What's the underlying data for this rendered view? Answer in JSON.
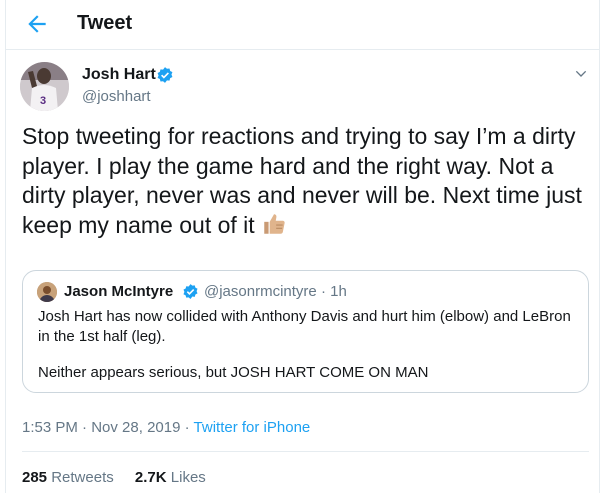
{
  "header": {
    "title": "Tweet",
    "back_icon": "arrow-left-icon"
  },
  "author": {
    "name": "Josh Hart",
    "handle": "@joshhart",
    "avatar_jersey_number": "3"
  },
  "tweet": {
    "text": "Stop tweeting for reactions and trying to say I’m a dirty player. I play the game hard and the right way. Not a dirty player, never was and never will be. Next time just keep my name out of it",
    "emoji": "thumbs-up-icon"
  },
  "quote": {
    "name": "Jason McIntyre",
    "handle": "@jasonrmcintyre",
    "separator": "·",
    "time": "1h",
    "paragraph1": "Josh Hart has now collided with Anthony Davis and hurt him (elbow) and LeBron in the 1st half (leg).",
    "paragraph2": "Neither appears serious, but JOSH HART COME ON MAN"
  },
  "meta": {
    "time": "1:53 PM",
    "separator": "·",
    "date": "Nov 28, 2019",
    "source": "Twitter for iPhone"
  },
  "stats": {
    "retweets_count": "285",
    "retweets_label": "Retweets",
    "likes_count": "2.7K",
    "likes_label": "Likes"
  },
  "colors": {
    "accent": "#1da1f2",
    "secondary_text": "#657786",
    "border": "#e6ecf0"
  }
}
